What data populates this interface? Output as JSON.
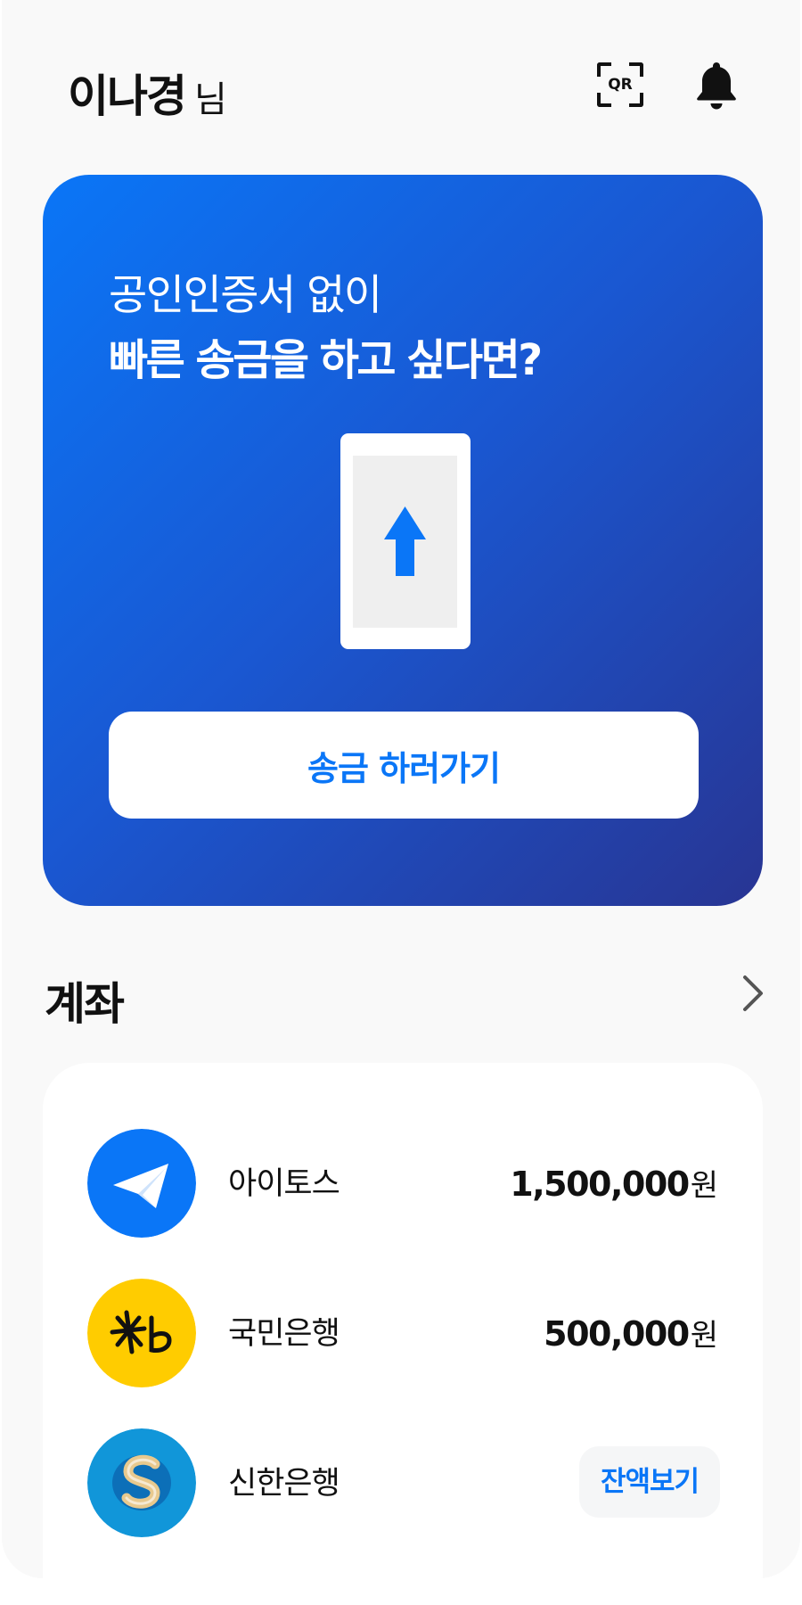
{
  "header": {
    "user_name": "이나경",
    "honorific": "님",
    "qr_label": "QR"
  },
  "promo": {
    "line1": "공인인증서 없이",
    "line2": "빠른 송금을 하고 싶다면?",
    "button_label": "송금 하러가기"
  },
  "accounts": {
    "title": "계좌",
    "items": [
      {
        "name": "아이토스",
        "balance": "1,500,000",
        "unit": "원",
        "logo_icon": "paper-plane-icon",
        "color": "#0a76f7"
      },
      {
        "name": "국민은행",
        "balance": "500,000",
        "unit": "원",
        "logo_icon": "kb-bank-icon",
        "color": "#ffcc00"
      },
      {
        "name": "신한은행",
        "balance_button": "잔액보기",
        "logo_icon": "shinhan-bank-icon",
        "color": "#1196d9"
      }
    ]
  },
  "colors": {
    "accent": "#0a76f7",
    "gradient_end": "#283593",
    "background": "#f9f9f9"
  }
}
